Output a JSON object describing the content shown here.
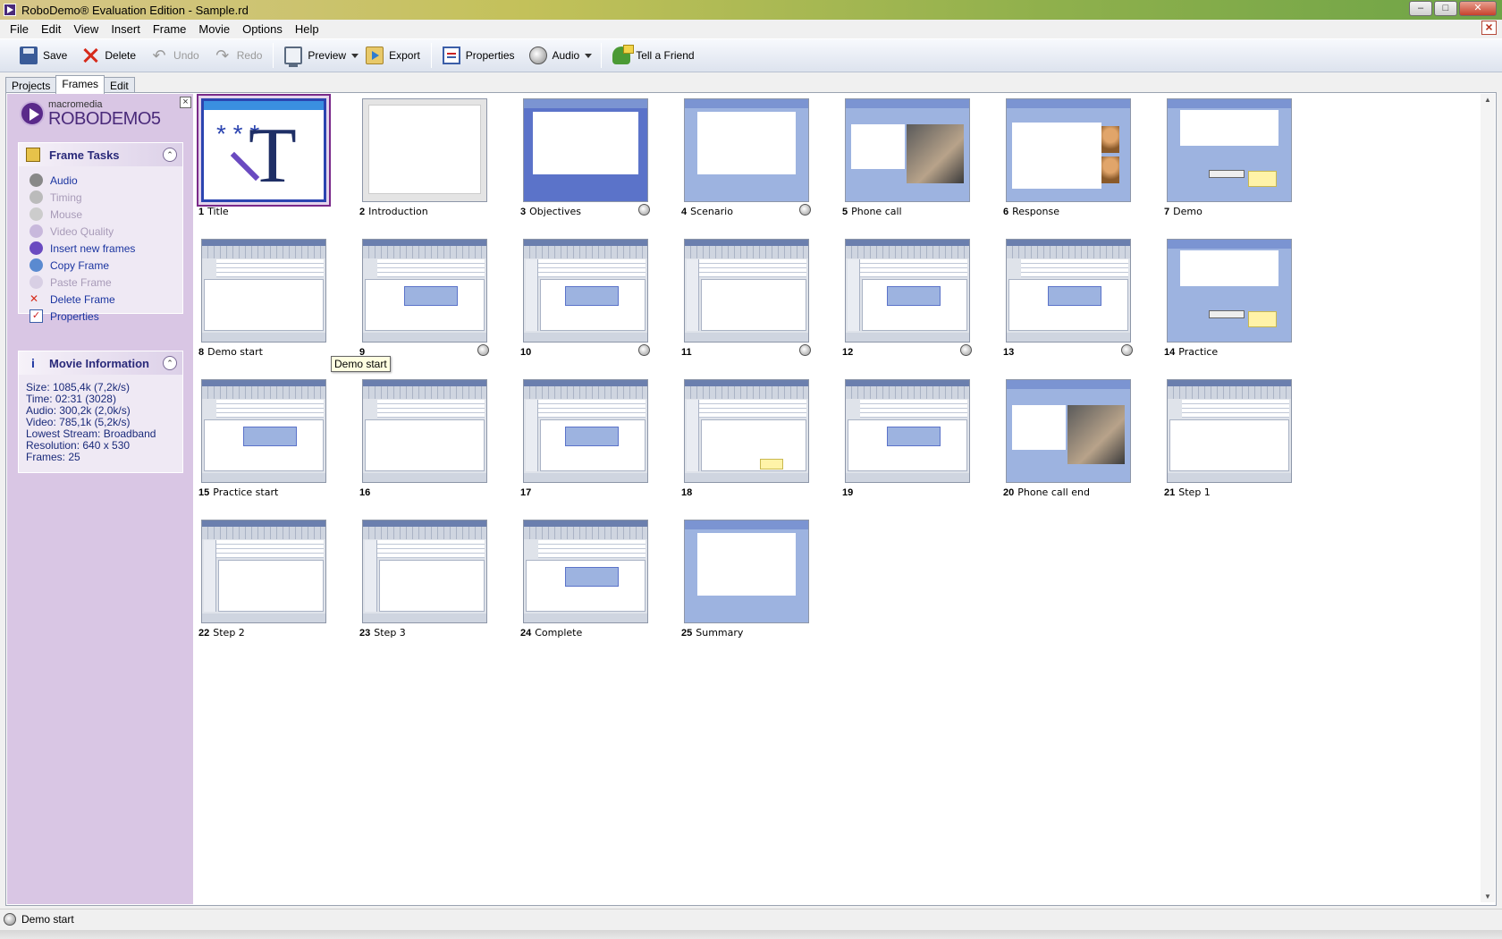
{
  "window": {
    "title": "RoboDemo® Evaluation Edition - Sample.rd"
  },
  "menu": [
    "File",
    "Edit",
    "View",
    "Insert",
    "Frame",
    "Movie",
    "Options",
    "Help"
  ],
  "toolbar": {
    "save": "Save",
    "delete": "Delete",
    "undo": "Undo",
    "redo": "Redo",
    "preview": "Preview",
    "export": "Export",
    "properties": "Properties",
    "audio": "Audio",
    "tell_friend": "Tell a Friend"
  },
  "tabs": [
    "Projects",
    "Frames",
    "Edit"
  ],
  "logo": {
    "brand": "macromedia",
    "product": "ROBODEMO5"
  },
  "frame_tasks": {
    "title": "Frame Tasks",
    "items": [
      {
        "label": "Audio",
        "enabled": true,
        "icon": "audio-icon"
      },
      {
        "label": "Timing",
        "enabled": false,
        "icon": "timing-icon"
      },
      {
        "label": "Mouse",
        "enabled": false,
        "icon": "mouse-icon"
      },
      {
        "label": "Video Quality",
        "enabled": false,
        "icon": "video-quality-icon"
      },
      {
        "label": "Insert new frames",
        "enabled": true,
        "icon": "insert-frames-icon"
      },
      {
        "label": "Copy Frame",
        "enabled": true,
        "icon": "copy-frame-icon"
      },
      {
        "label": "Paste Frame",
        "enabled": false,
        "icon": "paste-frame-icon"
      },
      {
        "label": "Delete Frame",
        "enabled": true,
        "icon": "delete-frame-icon"
      },
      {
        "label": "Properties",
        "enabled": true,
        "icon": "properties-icon"
      }
    ]
  },
  "movie_info": {
    "title": "Movie Information",
    "lines": [
      "Size: 1085,4k (7,2k/s)",
      "Time: 02:31 (3028)",
      "Audio: 300,2k (2,0k/s)",
      "Video: 785,1k (5,2k/s)",
      "Lowest Stream: Broadband",
      "Resolution: 640 x 530",
      "Frames: 25"
    ]
  },
  "frames": [
    {
      "num": "1",
      "name": "Title",
      "kind": "title",
      "badge": false
    },
    {
      "num": "2",
      "name": "Introduction",
      "kind": "grey",
      "badge": false
    },
    {
      "num": "3",
      "name": "Objectives",
      "kind": "blue-dark",
      "badge": true
    },
    {
      "num": "4",
      "name": "Scenario",
      "kind": "blue",
      "badge": true
    },
    {
      "num": "5",
      "name": "Phone call",
      "kind": "blue-photo",
      "badge": false
    },
    {
      "num": "6",
      "name": "Response",
      "kind": "blue-faces",
      "badge": false
    },
    {
      "num": "7",
      "name": "Demo",
      "kind": "blue-note",
      "badge": false
    },
    {
      "num": "8",
      "name": "Demo start",
      "kind": "word",
      "badge": false
    },
    {
      "num": "9",
      "name": "",
      "kind": "word-callout",
      "badge": true
    },
    {
      "num": "10",
      "name": "",
      "kind": "word-side-callout",
      "badge": true
    },
    {
      "num": "11",
      "name": "",
      "kind": "word-side",
      "badge": true
    },
    {
      "num": "12",
      "name": "",
      "kind": "word-side-callout",
      "badge": true
    },
    {
      "num": "13",
      "name": "",
      "kind": "word-callout",
      "badge": true
    },
    {
      "num": "14",
      "name": "Practice",
      "kind": "blue-note",
      "badge": false
    },
    {
      "num": "15",
      "name": "Practice start",
      "kind": "word-callout",
      "badge": false
    },
    {
      "num": "16",
      "name": "",
      "kind": "word",
      "badge": false
    },
    {
      "num": "17",
      "name": "",
      "kind": "word-side-callout",
      "badge": false
    },
    {
      "num": "18",
      "name": "",
      "kind": "word-side-yellow",
      "badge": false
    },
    {
      "num": "19",
      "name": "",
      "kind": "word-callout",
      "badge": false
    },
    {
      "num": "20",
      "name": "Phone call end",
      "kind": "blue-photo",
      "badge": false
    },
    {
      "num": "21",
      "name": "Step 1",
      "kind": "word",
      "badge": false
    },
    {
      "num": "22",
      "name": "Step 2",
      "kind": "word-side",
      "badge": false
    },
    {
      "num": "23",
      "name": "Step 3",
      "kind": "word-side",
      "badge": false
    },
    {
      "num": "24",
      "name": "Complete",
      "kind": "word-callout",
      "badge": false
    },
    {
      "num": "25",
      "name": "Summary",
      "kind": "blue",
      "badge": false
    }
  ],
  "tooltip": "Demo start",
  "status": "Demo start",
  "colors": {
    "sidebar": "#d9c6e4",
    "selection": "#7a2a8a",
    "link": "#1a34a0"
  }
}
